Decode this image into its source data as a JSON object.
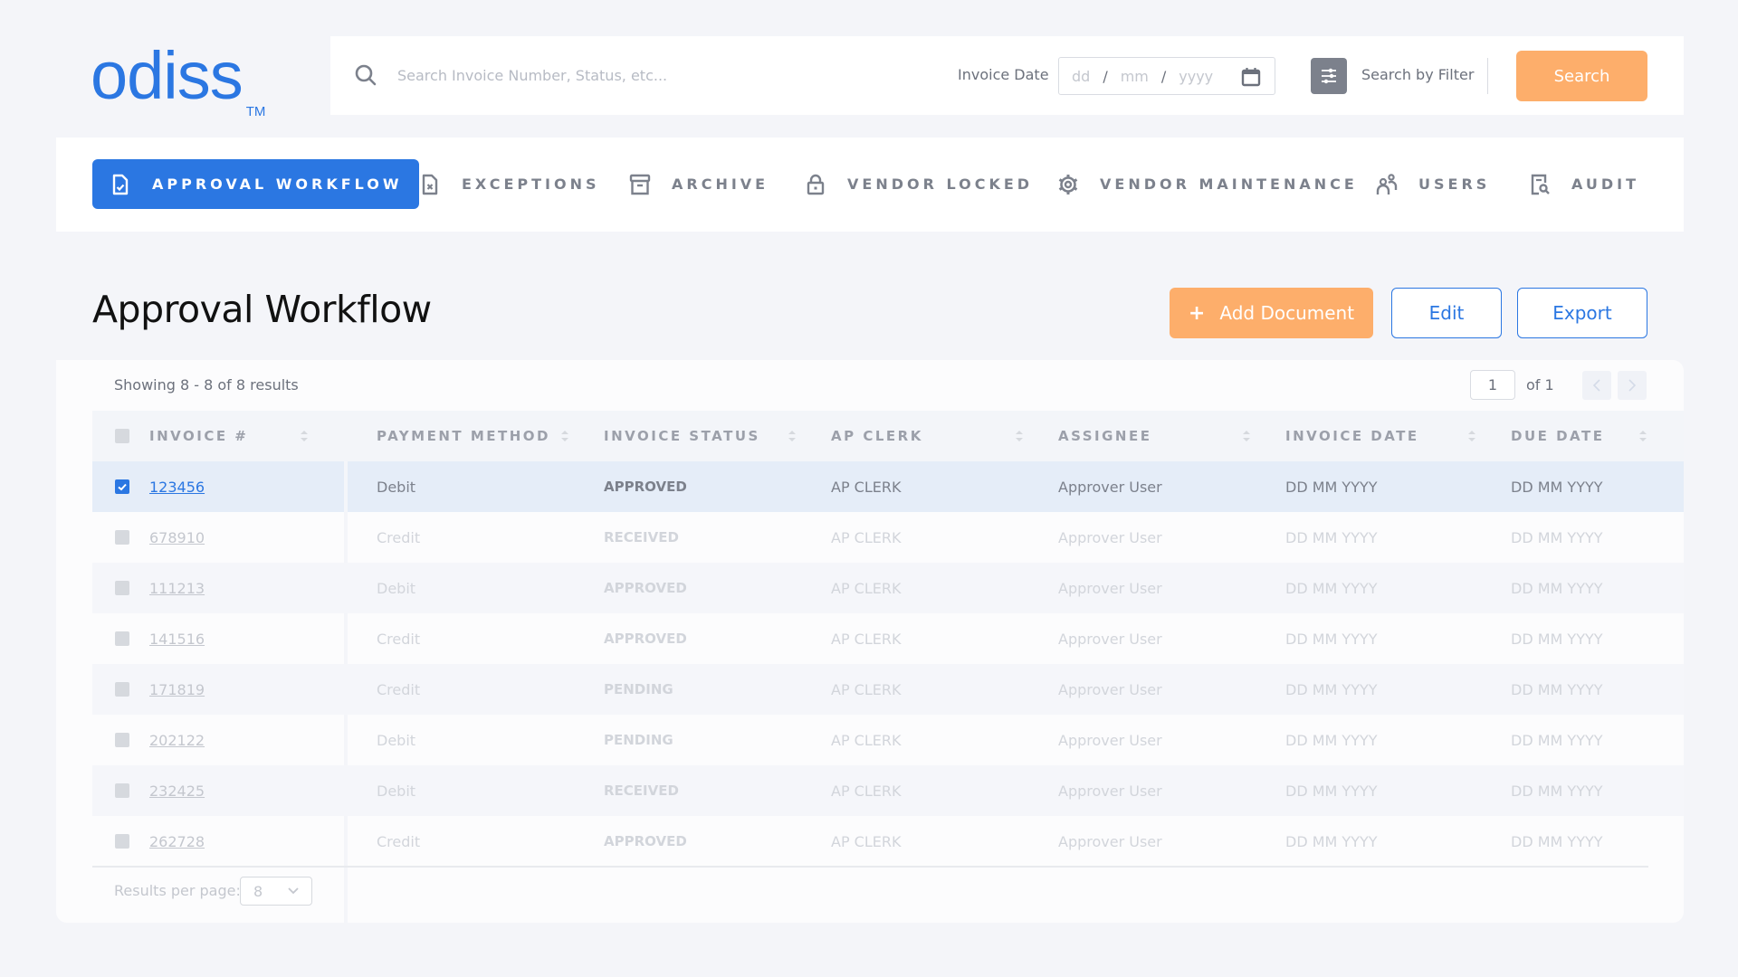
{
  "brand": {
    "name": "odiss",
    "trademark": "TM"
  },
  "topbar": {
    "search_placeholder": "Search Invoice Number, Status, etc...",
    "date_label": "Invoice Date",
    "date_placeholders": {
      "day": "dd",
      "month": "mm",
      "year": "yyyy",
      "separator": "/"
    },
    "filter_label": "Search by Filter",
    "search_button": "Search"
  },
  "nav": {
    "items": [
      {
        "label": "APPROVAL WORKFLOW",
        "icon": "document-check-icon",
        "active": true
      },
      {
        "label": "EXCEPTIONS",
        "icon": "document-x-icon",
        "active": false
      },
      {
        "label": "ARCHIVE",
        "icon": "archive-box-icon",
        "active": false
      },
      {
        "label": "VENDOR LOCKED",
        "icon": "lock-icon",
        "active": false
      },
      {
        "label": "VENDOR MAINTENANCE",
        "icon": "gear-icon",
        "active": false
      },
      {
        "label": "USERS",
        "icon": "users-icon",
        "active": false
      },
      {
        "label": "AUDIT",
        "icon": "document-search-icon",
        "active": false
      }
    ]
  },
  "page": {
    "title": "Approval Workflow",
    "add_button": "Add Document",
    "add_button_icon": "+",
    "edit_button": "Edit",
    "export_button": "Export"
  },
  "table": {
    "showing": "Showing 8 - 8 of 8 results",
    "pager": {
      "current": "1",
      "of_label": "of 1"
    },
    "columns": [
      "INVOICE #",
      "PAYMENT METHOD",
      "INVOICE STATUS",
      "AP CLERK",
      "ASSIGNEE",
      "INVOICE DATE",
      "DUE DATE"
    ],
    "rows": [
      {
        "checked": true,
        "invoice": "123456",
        "payment": "Debit",
        "status": "APPROVED",
        "clerk": "AP CLERK",
        "assignee": "Approver User",
        "invoice_date": "DD MM YYYY",
        "due_date": "DD MM YYYY"
      },
      {
        "checked": false,
        "invoice": "678910",
        "payment": "Credit",
        "status": "RECEIVED",
        "clerk": "AP CLERK",
        "assignee": "Approver User",
        "invoice_date": "DD MM YYYY",
        "due_date": "DD MM YYYY"
      },
      {
        "checked": false,
        "invoice": "111213",
        "payment": "Debit",
        "status": "APPROVED",
        "clerk": "AP CLERK",
        "assignee": "Approver User",
        "invoice_date": "DD MM YYYY",
        "due_date": "DD MM YYYY"
      },
      {
        "checked": false,
        "invoice": "141516",
        "payment": "Credit",
        "status": "APPROVED",
        "clerk": "AP CLERK",
        "assignee": "Approver User",
        "invoice_date": "DD MM YYYY",
        "due_date": "DD MM YYYY"
      },
      {
        "checked": false,
        "invoice": "171819",
        "payment": "Credit",
        "status": "PENDING",
        "clerk": "AP CLERK",
        "assignee": "Approver User",
        "invoice_date": "DD MM YYYY",
        "due_date": "DD MM YYYY"
      },
      {
        "checked": false,
        "invoice": "202122",
        "payment": "Debit",
        "status": "PENDING",
        "clerk": "AP CLERK",
        "assignee": "Approver User",
        "invoice_date": "DD MM YYYY",
        "due_date": "DD MM YYYY"
      },
      {
        "checked": false,
        "invoice": "232425",
        "payment": "Debit",
        "status": "RECEIVED",
        "clerk": "AP CLERK",
        "assignee": "Approver User",
        "invoice_date": "DD MM YYYY",
        "due_date": "DD MM YYYY"
      },
      {
        "checked": false,
        "invoice": "262728",
        "payment": "Credit",
        "status": "APPROVED",
        "clerk": "AP CLERK",
        "assignee": "Approver User",
        "invoice_date": "DD MM YYYY",
        "due_date": "DD MM YYYY"
      }
    ],
    "results_per_page_label": "Results per page:",
    "results_per_page": "8"
  },
  "colors": {
    "primary": "#2b77e2",
    "accent": "#fdae6b",
    "background": "#f4f5f9",
    "icon_gray": "#7c818c"
  }
}
